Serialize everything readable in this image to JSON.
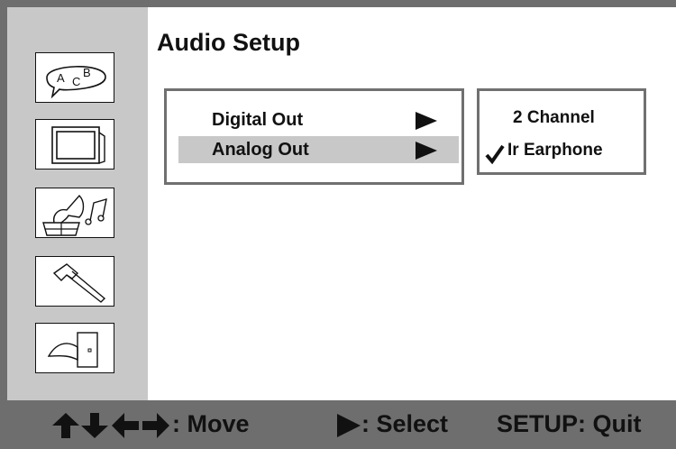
{
  "title": "Audio Setup",
  "sidebar": {
    "items": [
      {
        "icon": "language-speech-bubble-icon",
        "label": "A C B"
      },
      {
        "icon": "tv-display-icon"
      },
      {
        "icon": "gramophone-audio-icon"
      },
      {
        "icon": "hammer-tools-icon"
      },
      {
        "icon": "exit-door-icon"
      }
    ]
  },
  "menu": {
    "items": [
      {
        "label": "Digital Out",
        "selected": false
      },
      {
        "label": "Analog Out",
        "selected": true
      }
    ]
  },
  "options": {
    "items": [
      {
        "label": "2 Channel",
        "checked": false
      },
      {
        "label": "Ir Earphone",
        "checked": true
      }
    ]
  },
  "footer": {
    "move_label": ": Move",
    "select_label": ": Select",
    "quit_label": "SETUP: Quit"
  },
  "colors": {
    "frame": "#6e6e6e",
    "sidebar": "#c8c8c8",
    "highlight": "#c8c8c8",
    "text": "#111111"
  }
}
